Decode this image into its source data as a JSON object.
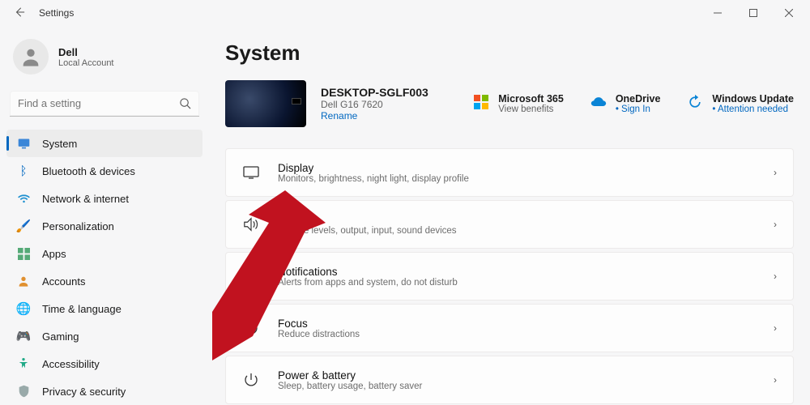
{
  "window": {
    "title": "Settings"
  },
  "profile": {
    "name": "Dell",
    "sub": "Local Account"
  },
  "search": {
    "placeholder": "Find a setting"
  },
  "sidebar": {
    "items": [
      {
        "label": "System"
      },
      {
        "label": "Bluetooth & devices"
      },
      {
        "label": "Network & internet"
      },
      {
        "label": "Personalization"
      },
      {
        "label": "Apps"
      },
      {
        "label": "Accounts"
      },
      {
        "label": "Time & language"
      },
      {
        "label": "Gaming"
      },
      {
        "label": "Accessibility"
      },
      {
        "label": "Privacy & security"
      }
    ]
  },
  "header": {
    "title": "System"
  },
  "device": {
    "name": "DESKTOP-SGLF003",
    "model": "Dell G16 7620",
    "rename": "Rename"
  },
  "quick": {
    "m365": {
      "title": "Microsoft 365",
      "sub": "View benefits"
    },
    "onedrive": {
      "title": "OneDrive",
      "sub": "Sign In"
    },
    "update": {
      "title": "Windows Update",
      "sub": "Attention needed"
    }
  },
  "rows": {
    "display": {
      "title": "Display",
      "sub": "Monitors, brightness, night light, display profile"
    },
    "sound": {
      "title": "Sound",
      "sub": "Volume levels, output, input, sound devices"
    },
    "notifications": {
      "title": "Notifications",
      "sub": "Alerts from apps and system, do not disturb"
    },
    "focus": {
      "title": "Focus",
      "sub": "Reduce distractions"
    },
    "power": {
      "title": "Power & battery",
      "sub": "Sleep, battery usage, battery saver"
    }
  }
}
